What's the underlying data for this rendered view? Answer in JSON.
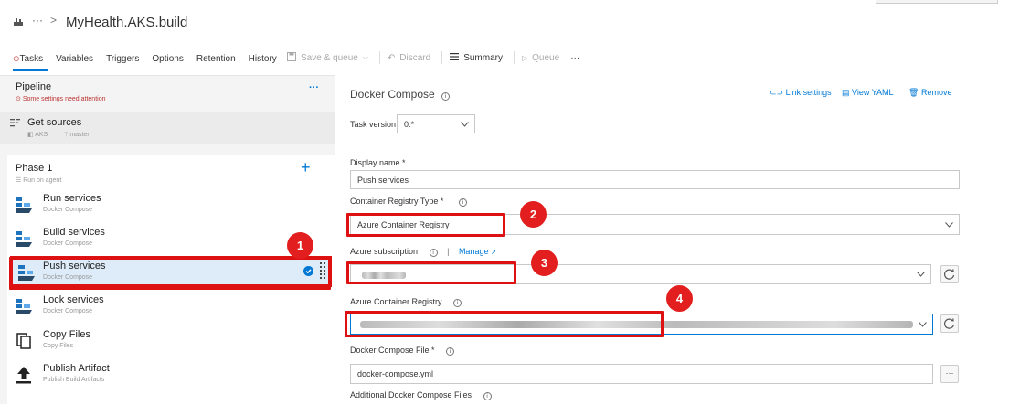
{
  "header": {
    "title": "MyHealth.AKS.build",
    "ellipsis": "···",
    "sep": ">"
  },
  "tabs": [
    {
      "label": "Tasks",
      "warn": "⓵"
    },
    {
      "label": "Variables"
    },
    {
      "label": "Triggers"
    },
    {
      "label": "Options"
    },
    {
      "label": "Retention"
    },
    {
      "label": "History"
    }
  ],
  "toolbar": {
    "save": "Save & queue",
    "discard": "Discard",
    "summary": "Summary",
    "queue": "Queue",
    "more": "···"
  },
  "pipeline": {
    "title": "Pipeline",
    "warning": "Some settings need attention",
    "more": "···"
  },
  "get_sources": {
    "title": "Get sources",
    "repo": "AKS",
    "branch": "master"
  },
  "phase": {
    "title": "Phase 1",
    "sub": "Run on agent",
    "add": "+"
  },
  "tasks": [
    {
      "name": "Run services",
      "sub": "Docker Compose"
    },
    {
      "name": "Build services",
      "sub": "Docker Compose"
    },
    {
      "name": "Push services",
      "sub": "Docker Compose"
    },
    {
      "name": "Lock services",
      "sub": "Docker Compose"
    },
    {
      "name": "Copy Files",
      "sub": "Copy Files"
    },
    {
      "name": "Publish Artifact",
      "sub": "Publish Build Artifacts"
    }
  ],
  "panel": {
    "title": "Docker Compose",
    "link_settings": "Link settings",
    "view_yaml": "View YAML",
    "remove": "Remove",
    "task_version_label": "Task version",
    "task_version": "0.*",
    "display_name_label": "Display name *",
    "display_name": "Push services",
    "registry_type_label": "Container Registry Type *",
    "registry_type": "Azure Container Registry",
    "subscription_label": "Azure subscription",
    "manage": "Manage",
    "acr_label": "Azure Container Registry",
    "compose_file_label": "Docker Compose File *",
    "compose_file": "docker-compose.yml",
    "additional_label": "Additional Docker Compose Files",
    "browse": "···"
  },
  "callouts": [
    "1",
    "2",
    "3",
    "4"
  ],
  "colors": {
    "accent": "#0078d4",
    "callout": "#e21e1e"
  }
}
